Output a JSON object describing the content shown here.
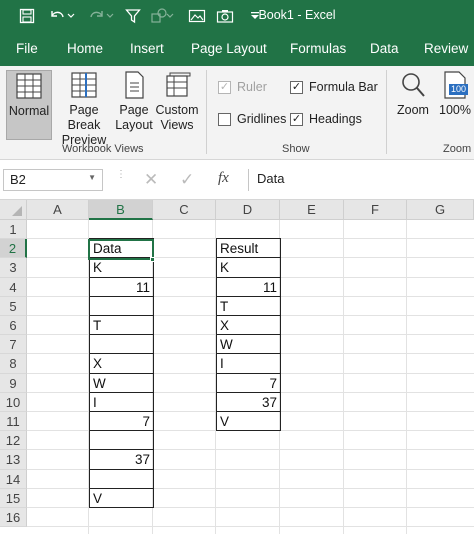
{
  "titlebar": {
    "title": "Book1  -  Excel"
  },
  "tabs": [
    "File",
    "Home",
    "Insert",
    "Page Layout",
    "Formulas",
    "Data",
    "Review"
  ],
  "ribbon": {
    "workbook_views": {
      "normal": "Normal",
      "page_break_1": "Page Break",
      "page_break_2": "Preview",
      "page_layout_1": "Page",
      "page_layout_2": "Layout",
      "custom_views_1": "Custom",
      "custom_views_2": "Views",
      "group_label": "Workbook Views"
    },
    "show": {
      "ruler": "Ruler",
      "formula_bar": "Formula Bar",
      "gridlines": "Gridlines",
      "headings": "Headings",
      "group_label": "Show"
    },
    "zoom": {
      "zoom": "Zoom",
      "pct": "100%",
      "badge": "100",
      "group_label": "Zoom"
    }
  },
  "formula_bar": {
    "name_box": "B2",
    "fx": "fx",
    "value": "Data"
  },
  "columns": [
    "A",
    "B",
    "C",
    "D",
    "E",
    "F",
    "G"
  ],
  "rows": [
    "1",
    "2",
    "3",
    "4",
    "5",
    "6",
    "7",
    "8",
    "9",
    "10",
    "11",
    "12",
    "13",
    "14",
    "15",
    "16"
  ],
  "data_column": [
    "Data",
    "K",
    "11",
    "",
    "T",
    "",
    "X",
    "W",
    "I",
    "7",
    "",
    "37",
    "",
    "V"
  ],
  "result_column": [
    "Result",
    "K",
    "11",
    "T",
    "X",
    "W",
    "I",
    "7",
    "37",
    "V"
  ],
  "colors": {
    "accent": "#217346"
  }
}
